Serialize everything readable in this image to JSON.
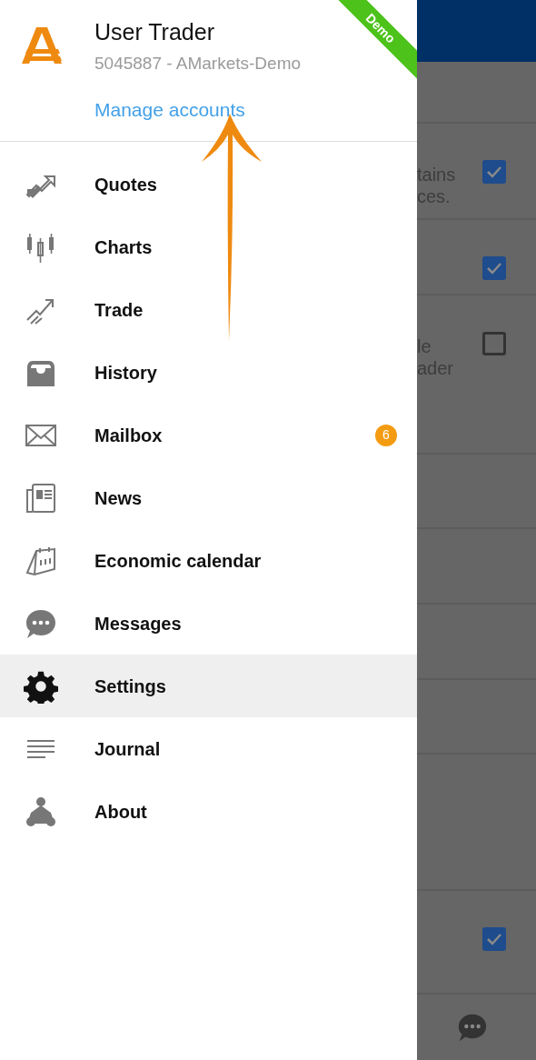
{
  "drawer": {
    "user_name": "User Trader",
    "account": "5045887 - AMarkets-Demo",
    "manage_link": "Manage accounts",
    "ribbon": "Demo",
    "items": [
      {
        "kind": "quotes",
        "label": "Quotes",
        "selected": false
      },
      {
        "kind": "charts",
        "label": "Charts",
        "selected": false
      },
      {
        "kind": "trade",
        "label": "Trade",
        "selected": false
      },
      {
        "kind": "history",
        "label": "History",
        "selected": false
      },
      {
        "kind": "mailbox",
        "label": "Mailbox",
        "selected": false,
        "badge": "6"
      },
      {
        "kind": "news",
        "label": "News",
        "selected": false
      },
      {
        "kind": "calendar",
        "label": "Economic calendar",
        "selected": false
      },
      {
        "kind": "messages",
        "label": "Messages",
        "selected": false
      },
      {
        "kind": "settings",
        "label": "Settings",
        "selected": true
      },
      {
        "kind": "journal",
        "label": "Journal",
        "selected": false
      },
      {
        "kind": "about",
        "label": "About",
        "selected": false
      }
    ]
  },
  "background": {
    "rows": [
      {
        "kind": "blank"
      },
      {
        "kind": "blank"
      },
      {
        "kind": "option",
        "lines": [
          "tains",
          "ces."
        ],
        "checked": true
      },
      {
        "kind": "option",
        "lines": [],
        "checked": true
      },
      {
        "kind": "option",
        "lines": [
          "le",
          "ader"
        ],
        "checked": false
      },
      {
        "kind": "blank"
      },
      {
        "kind": "blank"
      },
      {
        "kind": "blank"
      },
      {
        "kind": "blank"
      },
      {
        "kind": "blank"
      },
      {
        "kind": "option",
        "lines": [],
        "checked": true
      },
      {
        "kind": "chat"
      }
    ]
  }
}
